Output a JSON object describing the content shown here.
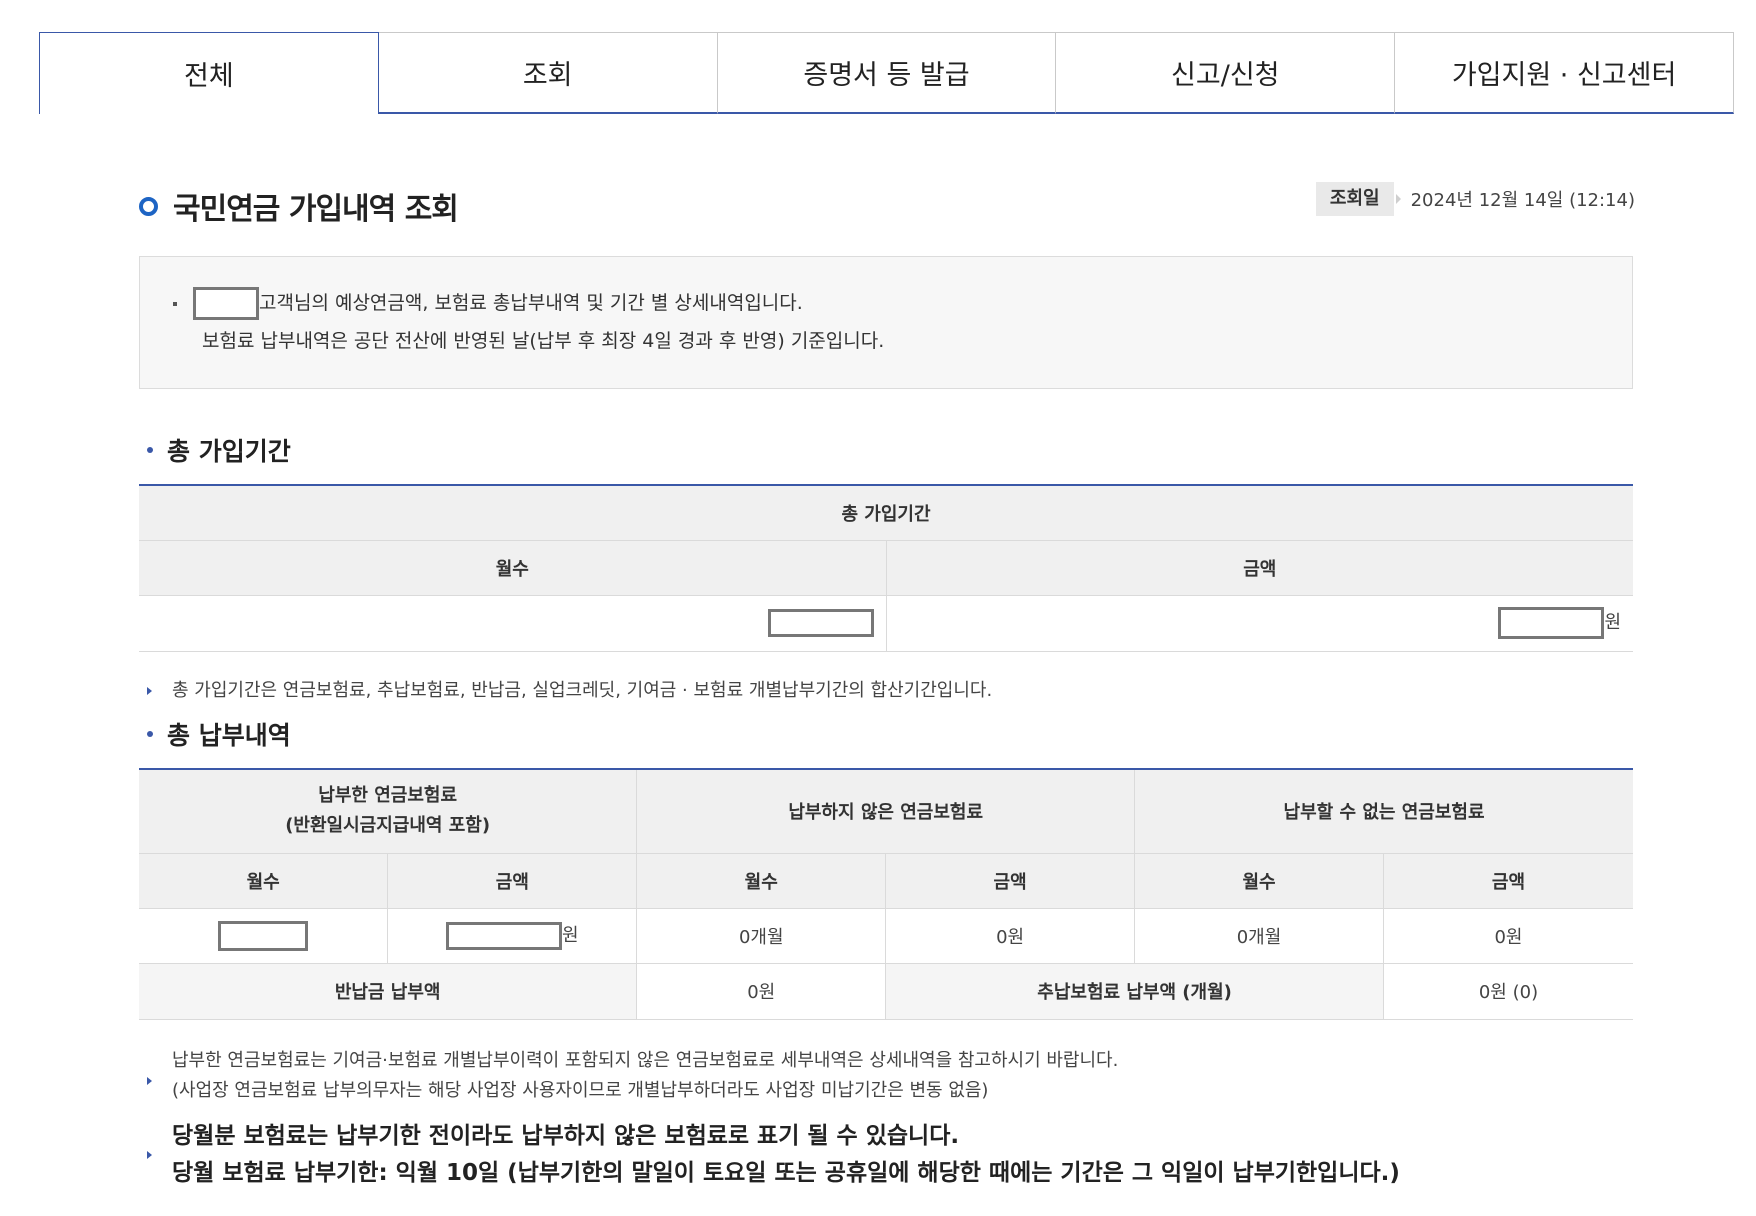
{
  "tabs": [
    {
      "label": "전체",
      "active": true
    },
    {
      "label": "조회"
    },
    {
      "label": "증명서 등 발급"
    },
    {
      "label": "신고/신청"
    },
    {
      "label": "가입지원 · 신고센터"
    }
  ],
  "page_title": "국민연금 가입내역 조회",
  "query_date": {
    "label": "조회일",
    "value": "2024년 12월 14일 (12:14)"
  },
  "info": {
    "line1_suffix": "고객님의 예상연금액, 보험료 총납부내역 및 기간 별 상세내역입니다.",
    "line2": "보험료 납부내역은 공단 전산에 반영된 날(납부 후 최장 4일 경과 후 반영) 기준입니다."
  },
  "section1": {
    "title": "총 가입기간",
    "table_title": "총 가입기간",
    "col_months": "월수",
    "col_amount": "금액",
    "amount_unit": "원",
    "note": "총 가입기간은 연금보험료, 추납보험료, 반납금, 실업크레딧, 기여금 · 보험료 개별납부기간의 합산기간입니다."
  },
  "section2": {
    "title": "총 납부내역",
    "group1_line1": "납부한 연금보험료",
    "group1_line2": "(반환일시금지급내역 포함)",
    "group2": "납부하지 않은 연금보험료",
    "group3": "납부할 수 없는 연금보험료",
    "col_months": "월수",
    "col_amount": "금액",
    "amount_unit": "원",
    "unpaid_months": "0개월",
    "unpaid_amount": "0원",
    "cannot_months": "0개월",
    "cannot_amount": "0원",
    "refund_label": "반납금 납부액",
    "refund_value": "0원",
    "late_label": "추납보험료 납부액 (개월)",
    "late_value": "0원 (0)"
  },
  "notes": {
    "note1_line1": "납부한 연금보험료는 기여금·보험료 개별납부이력이 포함되지 않은 연금보험료로 세부내역은 상세내역을 참고하시기 바랍니다.",
    "note1_line2": "(사업장 연금보험료 납부의무자는 해당 사업장 사용자이므로 개별납부하더라도 사업장 미납기간은 변동 없음)",
    "note2_line1": "당월분 보험료는 납부기한 전이라도 납부하지 않은 보험료로 표기 될 수 있습니다.",
    "note2_line2": "당월 보험료 납부기한: 익월 10일 (납부기한의 말일이 토요일 또는 공휴일에 해당한 때에는 기간은 그 익일이 납부기한입니다.)"
  },
  "colors": {
    "accent": "#3a58a8",
    "title_bullet": "#1d64c4"
  }
}
